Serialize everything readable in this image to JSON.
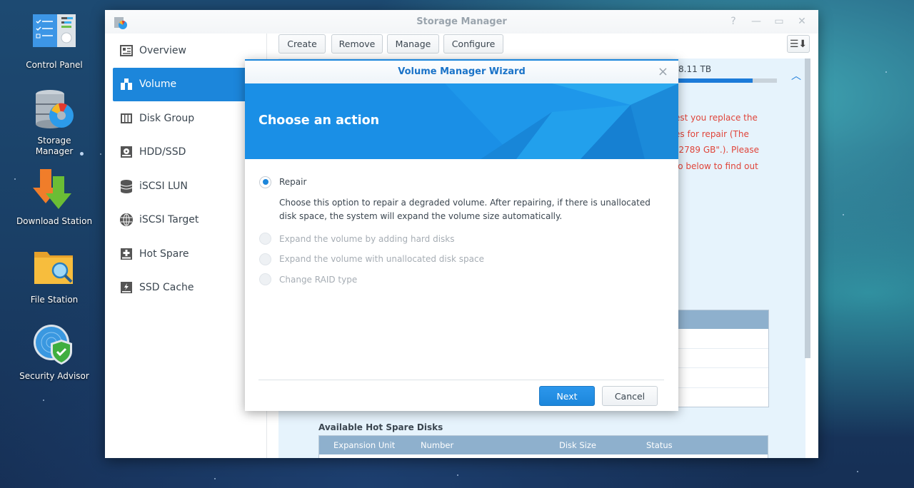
{
  "desktop": {
    "icons": [
      {
        "label": "Control Panel"
      },
      {
        "label": "Storage\nManager",
        "line1": "Storage",
        "line2": "Manager"
      },
      {
        "label": "Download Station"
      },
      {
        "label": "File Station"
      },
      {
        "label": "Security Advisor"
      }
    ]
  },
  "window": {
    "title": "Storage Manager",
    "controls": {
      "help": "?",
      "minimize": "—",
      "maximize": "▭",
      "close": "✕"
    }
  },
  "sidebar": {
    "items": [
      {
        "label": "Overview",
        "icon": "overview-icon"
      },
      {
        "label": "Volume",
        "icon": "volume-icon",
        "active": true
      },
      {
        "label": "Disk Group",
        "icon": "disk-group-icon"
      },
      {
        "label": "HDD/SSD",
        "icon": "hdd-icon"
      },
      {
        "label": "iSCSI LUN",
        "icon": "iscsi-lun-icon"
      },
      {
        "label": "iSCSI Target",
        "icon": "globe-icon"
      },
      {
        "label": "Hot Spare",
        "icon": "hot-spare-icon"
      },
      {
        "label": "SSD Cache",
        "icon": "ssd-cache-icon"
      }
    ]
  },
  "toolbar": {
    "create": "Create",
    "remove": "Remove",
    "manage": "Manage",
    "configure": "Configure",
    "sort_icon": "☰⬇"
  },
  "volume_panel": {
    "capacity_text": "8.11 TB",
    "capacity_used_fraction": 0.76,
    "warning_lines": [
      "est you replace the",
      "es for repair (The",
      "\"2789 GB\".). Please",
      "fo below to find out"
    ]
  },
  "hot_spare": {
    "title": "Available Hot Spare Disks",
    "columns": [
      "Expansion Unit",
      "Number",
      "Disk Size",
      "Status"
    ]
  },
  "dialog": {
    "title": "Volume Manager Wizard",
    "close": "×",
    "heading": "Choose an action",
    "options": [
      {
        "label": "Repair",
        "checked": true,
        "enabled": true,
        "description": "Choose this option to repair a degraded volume. After repairing, if there is unallocated disk space, the system will expand the volume size automatically."
      },
      {
        "label": "Expand the volume by adding hard disks",
        "checked": false,
        "enabled": false
      },
      {
        "label": "Expand the volume with unallocated disk space",
        "checked": false,
        "enabled": false
      },
      {
        "label": "Change RAID type",
        "checked": false,
        "enabled": false
      }
    ],
    "next": "Next",
    "cancel": "Cancel"
  },
  "colors": {
    "accent": "#1c86db",
    "warning": "#e0443a",
    "table_header": "#8eb0cd"
  }
}
